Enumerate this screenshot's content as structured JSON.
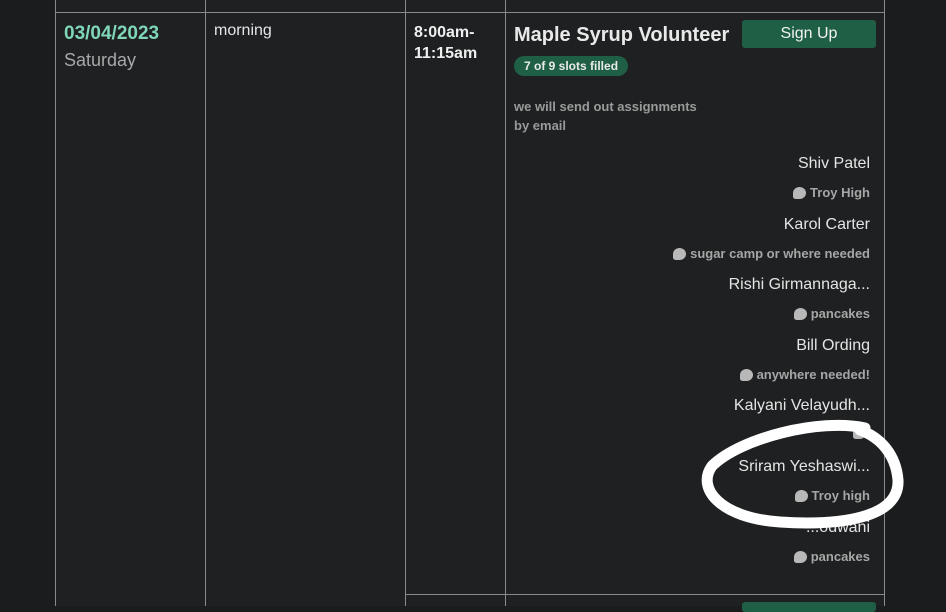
{
  "row": {
    "date": "03/04/2023",
    "weekday": "Saturday",
    "period": "morning",
    "time": "8:00am-\n11:15am",
    "time_line1": "8:00am-",
    "time_line2": "11:15am",
    "slot_title": "Maple Syrup Volunteer",
    "signup_label": "Sign Up",
    "slots_badge": "7 of 9 slots filled",
    "note": "we will send out assignments by email"
  },
  "signups": [
    {
      "name": "Shiv Patel",
      "comment": "Troy High"
    },
    {
      "name": "Karol Carter",
      "comment": "sugar camp or where needed"
    },
    {
      "name": "Rishi Girmannaga...",
      "comment": "pancakes"
    },
    {
      "name": "Bill Ording",
      "comment": "anywhere needed!"
    },
    {
      "name": "Kalyani Velayudh...",
      "comment": ""
    },
    {
      "name": "Sriram Yeshaswi...",
      "comment": "Troy high"
    },
    {
      "name": "...odwani",
      "comment": "pancakes"
    }
  ],
  "colors": {
    "background": "#1b1c1d",
    "accent_green": "#1f5f45",
    "date_teal": "#7fd6b8",
    "grid_line": "#8a8a8a",
    "scribble": "#ffffff"
  }
}
